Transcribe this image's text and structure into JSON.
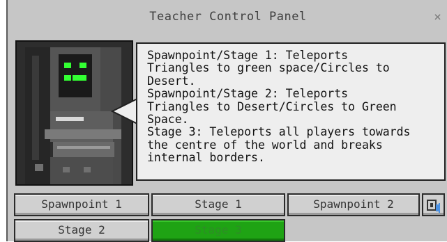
{
  "window": {
    "title": "Teacher Control Panel",
    "close_label": "×"
  },
  "npc": {
    "avatar_icon": "robot-npc-icon",
    "dialogue": "Spawnpoint/Stage 1: Teleports\nTriangles to green space/Circles to\nDesert.\nSpawnpoint/Stage 2: Teleports\nTriangles to Desert/Circles to Green\nSpace.\nStage 3: Teleports all players towards\nthe centre of the world and breaks\ninternal borders."
  },
  "buttons": [
    {
      "label": "Spawnpoint 1",
      "state": "normal"
    },
    {
      "label": "Stage 1",
      "state": "normal"
    },
    {
      "label": "Spawnpoint 2",
      "state": "normal"
    },
    {
      "label": "Stage 2",
      "state": "normal"
    },
    {
      "label": "Stage 3",
      "state": "selected"
    }
  ],
  "speaker_icon": "speaker-icon",
  "colors": {
    "panel_bg": "#c6c6c6",
    "selected_button": "#1fa314"
  }
}
